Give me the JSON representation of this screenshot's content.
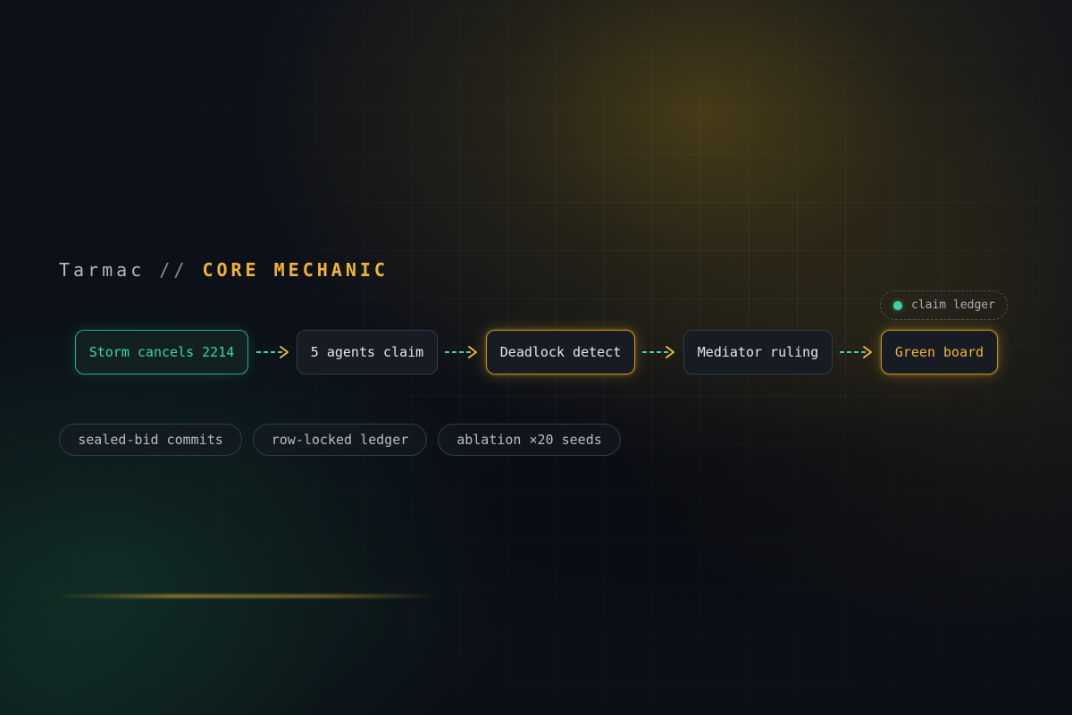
{
  "title": {
    "brand": "Tarmac",
    "separator": "//",
    "mechanic": "CORE MECHANIC"
  },
  "flow": {
    "nodes": [
      {
        "label": "Storm cancels 2214",
        "style": "green"
      },
      {
        "label": "5 agents claim",
        "style": "neutral"
      },
      {
        "label": "Deadlock detect",
        "style": "amber"
      },
      {
        "label": "Mediator ruling",
        "style": "neutral"
      },
      {
        "label": "Green board",
        "style": "amber"
      }
    ],
    "badge": {
      "label": "claim ledger",
      "icon": "status-dot-icon"
    }
  },
  "chips": [
    "sealed-bid commits",
    "row-locked ledger",
    "ablation ×20 seeds"
  ],
  "colors": {
    "accent_amber": "#f2b530",
    "accent_green": "#3fd3a6",
    "node_bg": "#161b24",
    "page_bg": "#0b0f16"
  }
}
